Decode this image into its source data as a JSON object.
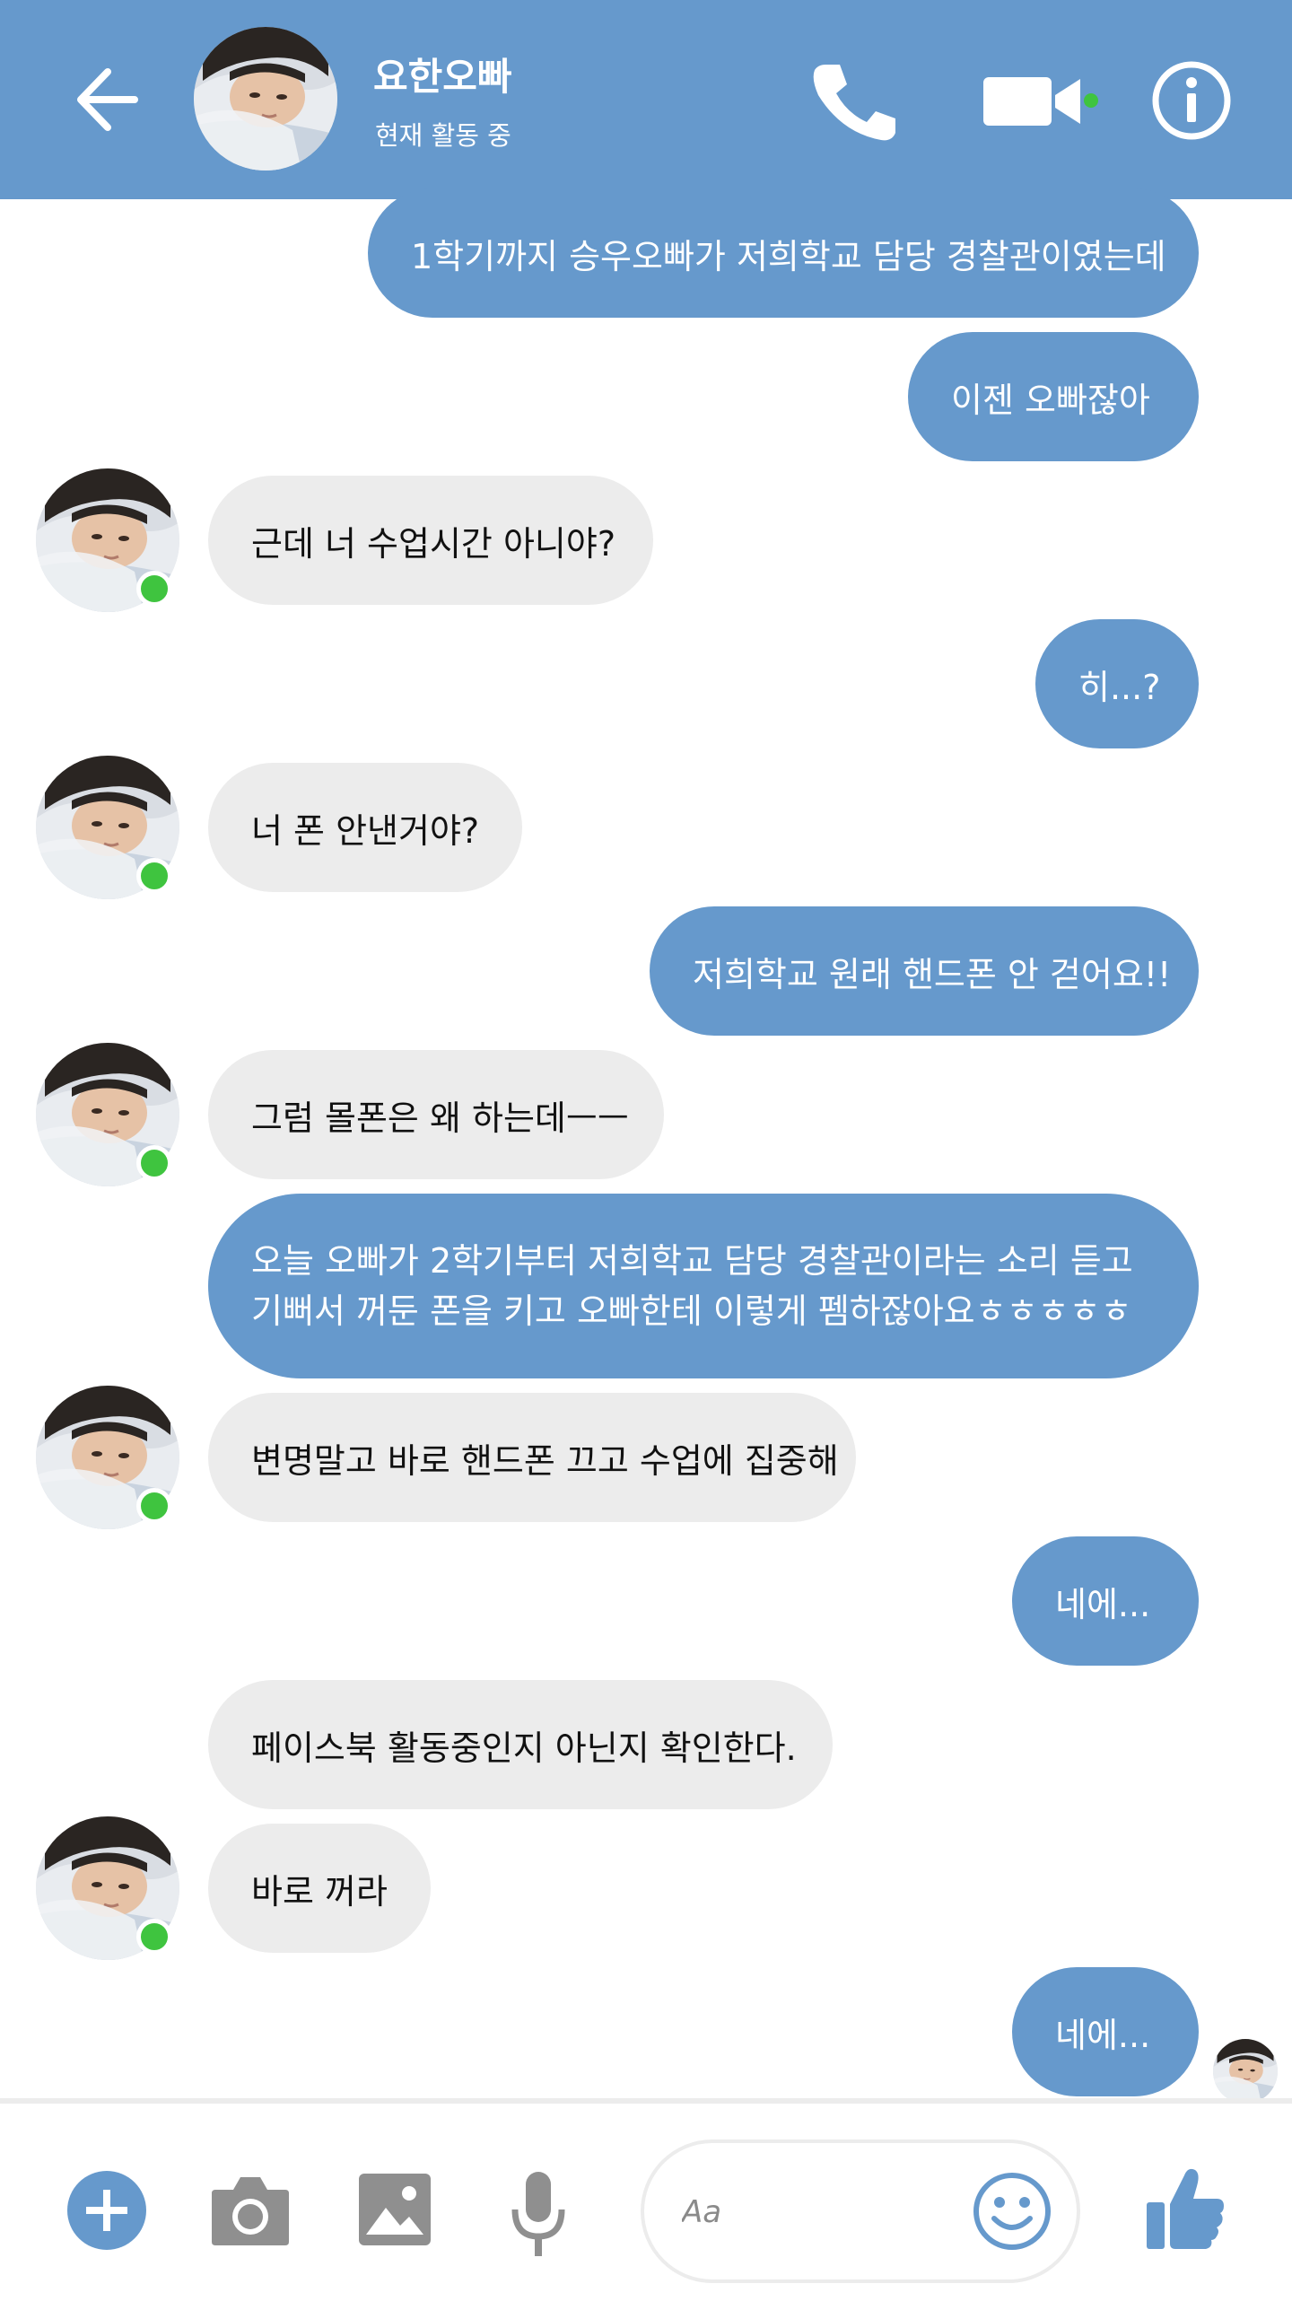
{
  "header": {
    "contact_name": "요한오빠",
    "status_text": "현재 활동 중",
    "icons": [
      "back-arrow-icon",
      "phone-icon",
      "video-camera-icon",
      "info-icon"
    ]
  },
  "messages": [
    {
      "sender": "me",
      "text": "1학기까지 승우오빠가 저희학교 담당 경찰관이였는데"
    },
    {
      "sender": "me",
      "text": "이젠 오빠잖아"
    },
    {
      "sender": "them",
      "text": "근데 너 수업시간 아니야?"
    },
    {
      "sender": "me",
      "text": "히...?"
    },
    {
      "sender": "them",
      "text": "너 폰 안낸거야?"
    },
    {
      "sender": "me",
      "text": "저희학교 원래 핸드폰 안 걷어요!!"
    },
    {
      "sender": "them",
      "text": "그럼 몰폰은 왜 하는데ㅡㅡ"
    },
    {
      "sender": "me",
      "text": "오늘 오빠가 2학기부터 저희학교 담당 경찰관이라는 소리 듣고 기뻐서 꺼둔 폰을 키고 오빠한테 이렇게 펨하잖아요ㅎㅎㅎㅎㅎ"
    },
    {
      "sender": "them",
      "text": "변명말고 바로 핸드폰 끄고 수업에 집중해"
    },
    {
      "sender": "me",
      "text": "네에..."
    },
    {
      "sender": "them",
      "text": "페이스북 활동중인지 아닌지 확인한다."
    },
    {
      "sender": "them",
      "text": "바로 꺼라"
    },
    {
      "sender": "me",
      "text": "네에..."
    }
  ],
  "composer": {
    "placeholder": "Aa",
    "icons": [
      "plus-icon",
      "camera-icon",
      "image-icon",
      "microphone-icon",
      "emoji-icon",
      "thumbs-up-icon"
    ]
  },
  "colors": {
    "accent": "#6699cc",
    "incoming_bubble": "#ececec",
    "online": "#3fc43f"
  }
}
